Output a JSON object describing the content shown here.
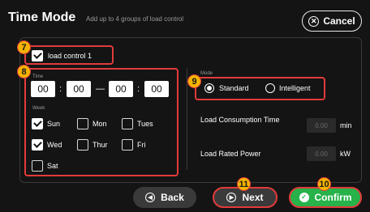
{
  "header": {
    "title": "Time Mode",
    "subtitle": "Add up to 4 groups of load control",
    "cancel_label": "Cancel"
  },
  "load_control": {
    "label": "load control 1",
    "checked": true
  },
  "time": {
    "label": "Time",
    "start_hour": "00",
    "start_min": "00",
    "end_hour": "00",
    "end_min": "00",
    "colon": ":",
    "dash": "—"
  },
  "week": {
    "label": "Week",
    "days": [
      {
        "label": "Sun",
        "checked": true
      },
      {
        "label": "Mon",
        "checked": false
      },
      {
        "label": "Tues",
        "checked": false
      },
      {
        "label": "Wed",
        "checked": true
      },
      {
        "label": "Thur",
        "checked": false
      },
      {
        "label": "Fri",
        "checked": false
      },
      {
        "label": "Sat",
        "checked": false
      }
    ]
  },
  "mode": {
    "label": "Mode",
    "options": [
      {
        "label": "Standard",
        "selected": true
      },
      {
        "label": "Intelligent",
        "selected": false
      }
    ]
  },
  "consumption": {
    "label": "Load Consumption Time",
    "value": "0.00",
    "unit": "min"
  },
  "power": {
    "label": "Load Rated Power",
    "value": "0.00",
    "unit": "kW"
  },
  "footer": {
    "back_label": "Back",
    "next_label": "Next",
    "confirm_label": "Confirm"
  },
  "badges": {
    "b7": "7",
    "b8": "8",
    "b9": "9",
    "b10": "10",
    "b11": "11"
  },
  "colors": {
    "accent_green": "#27b24a",
    "highlight_red": "#e23b3b",
    "badge_yellow": "#f5b400"
  }
}
